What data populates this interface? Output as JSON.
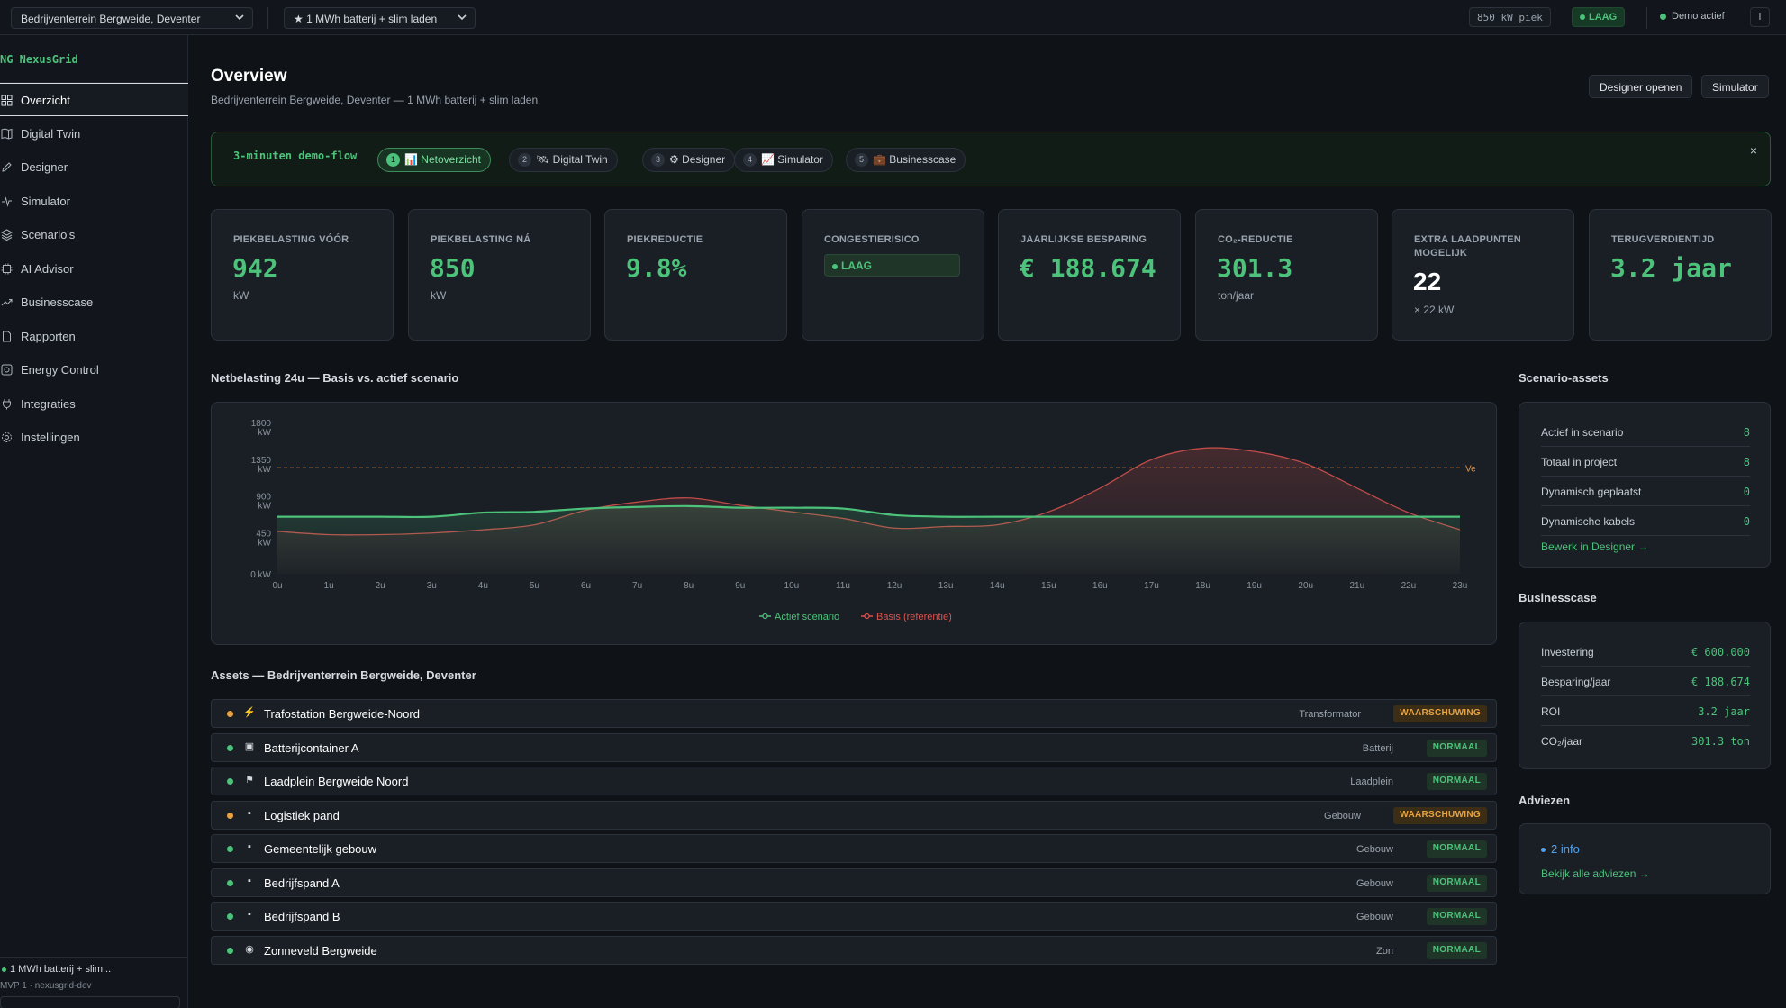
{
  "topbar": {
    "location": "Bedrijventerrein Bergweide, Deventer",
    "scenario": "★ 1 MWh batterij + slim laden",
    "peak": "850 kW piek",
    "risk": "LAAG",
    "demo": "Demo actief",
    "info": "i"
  },
  "sidebar": {
    "logo": "NG  NexusGrid",
    "items": [
      {
        "label": "Overzicht",
        "icon": "grid-icon",
        "active": true
      },
      {
        "label": "Digital Twin",
        "icon": "map-icon"
      },
      {
        "label": "Designer",
        "icon": "pencil-icon"
      },
      {
        "label": "Simulator",
        "icon": "pulse-icon"
      },
      {
        "label": "Scenario's",
        "icon": "layers-icon"
      },
      {
        "label": "AI Advisor",
        "icon": "chip-icon"
      },
      {
        "label": "Businesscase",
        "icon": "trend-icon"
      },
      {
        "label": "Rapporten",
        "icon": "document-icon"
      },
      {
        "label": "Energy Control",
        "icon": "control-icon"
      },
      {
        "label": "Integraties",
        "icon": "plug-icon"
      },
      {
        "label": "Instellingen",
        "icon": "gear-icon"
      }
    ],
    "footer_scenario": "1 MWh batterij + slim...",
    "footer_version": "MVP 1 · nexusgrid-dev"
  },
  "header": {
    "title": "Overview",
    "subtitle": "Bedrijventerrein Bergweide, Deventer — 1 MWh batterij + slim laden",
    "designer_button": "Designer openen",
    "simulator_button": "Simulator"
  },
  "demo_flow": {
    "title": "3-minuten demo-flow",
    "steps": [
      {
        "num": "1",
        "label": "📊 Netoverzicht",
        "active": true
      },
      {
        "num": "2",
        "label": "🛰 Digital Twin"
      },
      {
        "num": "3",
        "label": "⚙ Designer"
      },
      {
        "num": "4",
        "label": "📈 Simulator"
      },
      {
        "num": "5",
        "label": "💼 Businesscase"
      }
    ],
    "close": "×"
  },
  "kpis": [
    {
      "label": "PIEKBELASTING VÓÓR",
      "value": "942",
      "unit": "kW",
      "color": "#e8943f"
    },
    {
      "label": "PIEKBELASTING NÁ",
      "value": "850",
      "unit": "kW",
      "color": "#4cc27a"
    },
    {
      "label": "PIEKREDUCTIE",
      "value": "9.8%",
      "unit": "",
      "color": "#4cc27a"
    },
    {
      "label": "CONGESTIERISICO",
      "badge": "LAAG",
      "color": "#4cc27a"
    },
    {
      "label": "JAARLIJKSE BESPARING",
      "value": "€ 188.674",
      "unit": "",
      "color": "#4cc27a"
    },
    {
      "label": "CO₂-REDUCTIE",
      "value": "301.3",
      "unit": "ton/jaar",
      "color": "#4cc27a"
    },
    {
      "label": "EXTRA LAADPUNTEN MOGELIJK",
      "value": "22",
      "unit": "× 22 kW",
      "color": "#ffffff"
    },
    {
      "label": "TERUGVERDIENTIJD",
      "value": "3.2 jaar",
      "unit": "",
      "color": "#4cc27a"
    }
  ],
  "chart_title": "Netbelasting 24u — Basis vs. actief scenario",
  "chart_data": {
    "type": "line",
    "x": [
      "0u",
      "1u",
      "2u",
      "3u",
      "4u",
      "5u",
      "6u",
      "7u",
      "8u",
      "9u",
      "10u",
      "11u",
      "12u",
      "13u",
      "14u",
      "15u",
      "16u",
      "17u",
      "18u",
      "19u",
      "20u",
      "21u",
      "22u",
      "23u"
    ],
    "ylim": [
      0,
      1800
    ],
    "yticks": [
      "0 kW",
      "450 kW",
      "900 kW",
      "1350 kW",
      "1800 kW"
    ],
    "ytick_values": [
      0,
      450,
      900,
      1350,
      1800
    ],
    "threshold": {
      "value": 1300,
      "label": "Ve",
      "color": "#e8943f"
    },
    "series": [
      {
        "name": "Actief scenario",
        "color": "#4cc27a",
        "values": [
          700,
          700,
          700,
          700,
          750,
          760,
          800,
          820,
          830,
          810,
          810,
          800,
          720,
          700,
          700,
          700,
          700,
          700,
          700,
          700,
          700,
          700,
          700,
          700
        ]
      },
      {
        "name": "Basis (referentie)",
        "color": "#d9534f",
        "values": [
          520,
          480,
          480,
          500,
          540,
          600,
          780,
          880,
          930,
          840,
          760,
          680,
          560,
          580,
          600,
          760,
          1050,
          1400,
          1540,
          1500,
          1350,
          1050,
          750,
          540
        ]
      }
    ],
    "legend_position": "bottom"
  },
  "assets": {
    "title": "Assets — Bedrijventerrein Bergweide, Deventer",
    "rows": [
      {
        "name": "Trafostation Bergweide-Noord",
        "icon": "⚡",
        "type": "Transformator",
        "status": "WAARSCHUWING",
        "level": "warn"
      },
      {
        "name": "Batterijcontainer A",
        "icon": "▣",
        "type": "Batterij",
        "status": "NORMAAL",
        "level": "ok"
      },
      {
        "name": "Laadplein Bergweide Noord",
        "icon": "⚑",
        "type": "Laadplein",
        "status": "NORMAAL",
        "level": "ok"
      },
      {
        "name": "Logistiek pand",
        "icon": "▪",
        "type": "Gebouw",
        "status": "WAARSCHUWING",
        "level": "warn"
      },
      {
        "name": "Gemeentelijk gebouw",
        "icon": "▪",
        "type": "Gebouw",
        "status": "NORMAAL",
        "level": "ok"
      },
      {
        "name": "Bedrijfspand A",
        "icon": "▪",
        "type": "Gebouw",
        "status": "NORMAAL",
        "level": "ok"
      },
      {
        "name": "Bedrijfspand B",
        "icon": "▪",
        "type": "Gebouw",
        "status": "NORMAAL",
        "level": "ok"
      },
      {
        "name": "Zonneveld Bergweide",
        "icon": "◉",
        "type": "Zon",
        "status": "NORMAAL",
        "level": "ok"
      }
    ]
  },
  "scenario_assets": {
    "title": "Scenario-assets",
    "rows": [
      {
        "k": "Actief in scenario",
        "v": "8"
      },
      {
        "k": "Totaal in project",
        "v": "8"
      },
      {
        "k": "Dynamisch geplaatst",
        "v": "0"
      },
      {
        "k": "Dynamische kabels",
        "v": "0"
      }
    ],
    "link": "Bewerk in Designer →"
  },
  "businesscase": {
    "title": "Businesscase",
    "rows": [
      {
        "k": "Investering",
        "v": "€ 600.000"
      },
      {
        "k": "Besparing/jaar",
        "v": "€ 188.674"
      },
      {
        "k": "ROI",
        "v": "3.2 jaar"
      },
      {
        "k": "CO₂/jaar",
        "v": "301.3 ton"
      }
    ]
  },
  "adviezen": {
    "title": "Adviezen",
    "info": "2 info",
    "link": "Bekijk alle adviezen →"
  }
}
